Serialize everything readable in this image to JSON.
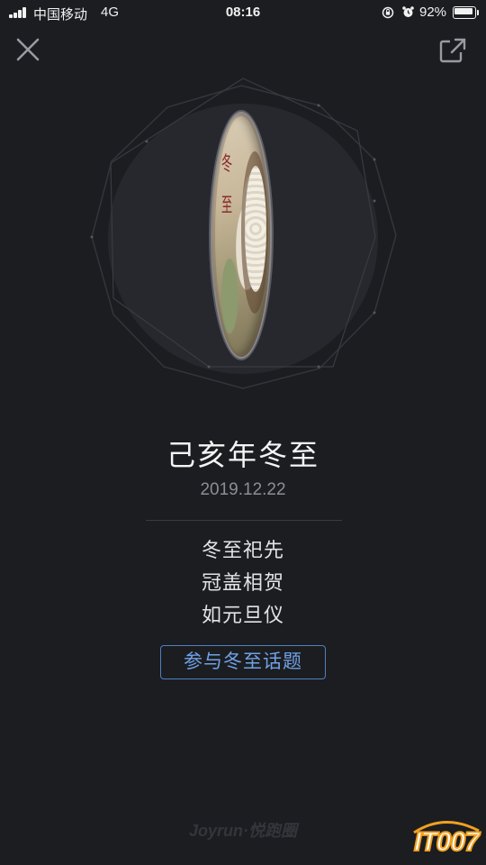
{
  "status_bar": {
    "carrier": "中国移动",
    "network": "4G",
    "time": "08:16",
    "battery": "92%",
    "battery_level": 0.92
  },
  "header": {
    "close_icon": "close-icon",
    "share_icon": "share-icon"
  },
  "medal": {
    "chars": [
      "冬",
      "至"
    ]
  },
  "content": {
    "title": "己亥年冬至",
    "date": "2019.12.22",
    "verse": [
      "冬至祀先",
      "冠盖相贺",
      "如元旦仪"
    ],
    "topic_button": "参与冬至话题"
  },
  "footer": {
    "brand": "Joyrun·悦跑圈",
    "watermark": "IT007"
  },
  "colors": {
    "background": "#1c1d21",
    "accent": "#6fa2e6",
    "watermark_orange": "#f0a020"
  }
}
